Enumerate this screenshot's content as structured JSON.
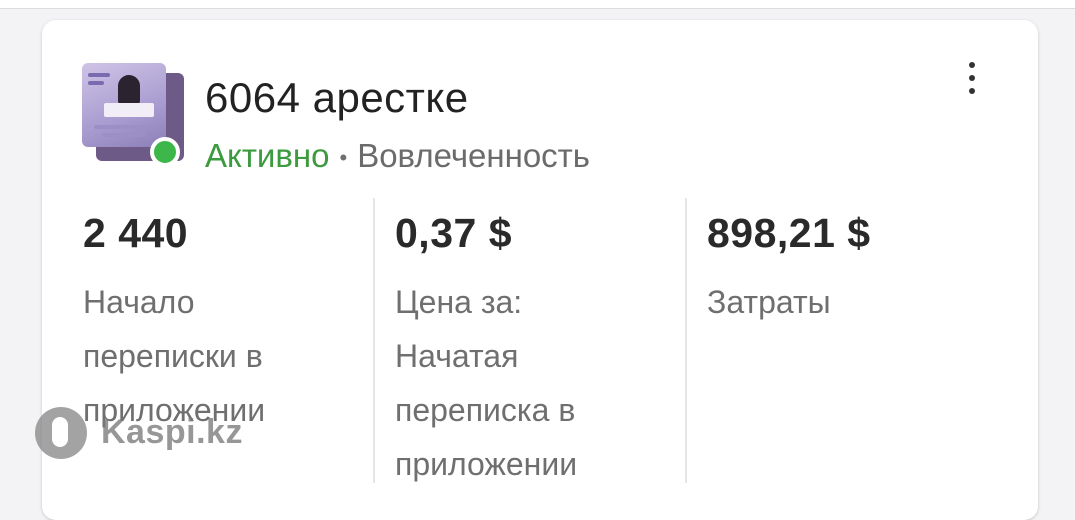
{
  "campaign": {
    "title": "6064 арестке",
    "status": "Активно",
    "separator": "•",
    "objective": "Вовлеченность"
  },
  "metrics": [
    {
      "value": "2 440",
      "label": "Начало переписки в приложении"
    },
    {
      "value": "0,37 $",
      "label": "Цена за: Начатая переписка в приложении"
    },
    {
      "value": "898,21 $",
      "label": "Затраты"
    }
  ],
  "watermark": {
    "text": "Kaspi.kz"
  },
  "icons": {
    "more": "more-vertical-icon",
    "status": "status-dot-icon"
  },
  "colors": {
    "status_active": "#3c9a3f",
    "status_dot": "#3db64a"
  }
}
